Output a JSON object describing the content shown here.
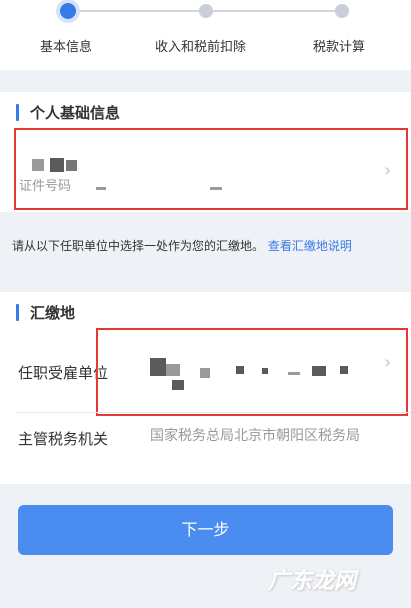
{
  "stepper": {
    "steps": [
      {
        "label": "基本信息",
        "state": "active"
      },
      {
        "label": "收入和税前扣除",
        "state": "pending"
      },
      {
        "label": "税款计算",
        "state": "pending"
      }
    ]
  },
  "personal": {
    "title": "个人基础信息",
    "id_label": "证件号码",
    "chevron": "›"
  },
  "notice": {
    "text": "请从以下任职单位中选择一处作为您的汇缴地。",
    "link": "查看汇缴地说明"
  },
  "payment": {
    "title": "汇缴地",
    "employer_label": "任职受雇单位",
    "chevron": "›",
    "tax_office_label": "主管税务机关",
    "tax_office_value": "国家税务总局北京市朝阳区税务局"
  },
  "next_button": {
    "label": "下一步"
  },
  "watermark": "广东龙网",
  "colors": {
    "accent": "#3a7ae6",
    "button": "#4b8cf0",
    "highlight_border": "#e53935"
  }
}
